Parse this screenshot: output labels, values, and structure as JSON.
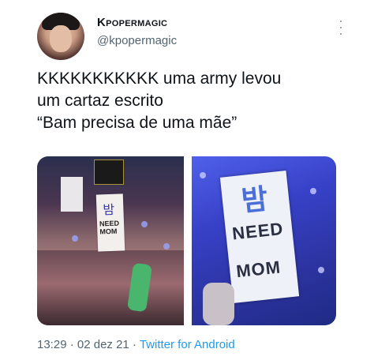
{
  "author": {
    "display_name": "Kpopermagic",
    "handle": "@kpopermagic"
  },
  "tweet": {
    "text": "KKKKKKKKKKK uma army levou\num cartaz escrito\n“Bam precisa de uma mãe”"
  },
  "media": {
    "left_sign": {
      "hangul": "밤",
      "text": "NEED MOM"
    },
    "right_sign": {
      "hangul": "밤",
      "line1": "NEED",
      "line2": "MOM"
    }
  },
  "meta": {
    "time": "13:29",
    "separator1": " · ",
    "date": "02 dez 21",
    "separator2": " · ",
    "source": "Twitter for Android"
  },
  "icons": {
    "more": "more-options-icon"
  }
}
